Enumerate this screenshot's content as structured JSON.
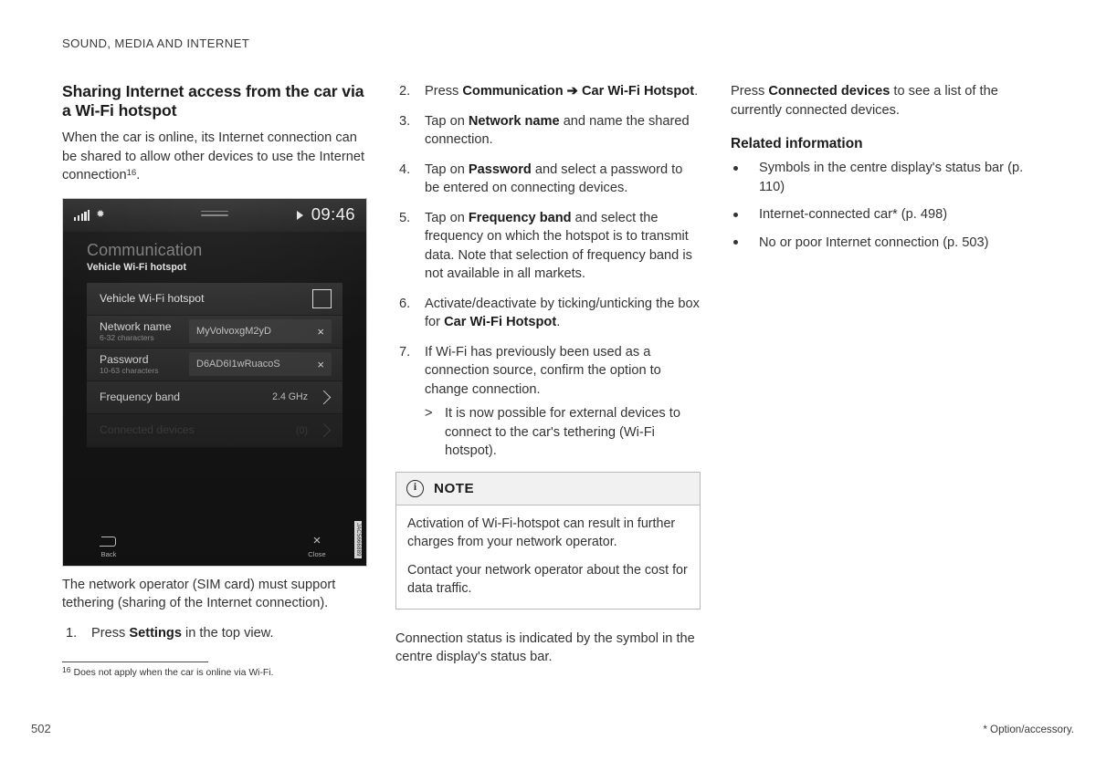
{
  "running_head": "SOUND, MEDIA AND INTERNET",
  "page_number": "502",
  "option_note": "* Option/accessory.",
  "column1": {
    "heading": "Sharing Internet access from the car via a Wi-Fi hotspot",
    "intro_a": "When the car is online, its Internet connection can be shared to allow other devices to use the Internet connection",
    "intro_footnote_marker": "16",
    "intro_b": ".",
    "caption_a": "The network operator (SIM card) must support tethering (sharing of the Internet connection).",
    "step1_num": "1.",
    "step1_a": "Press ",
    "step1_bold": "Settings",
    "step1_b": " in the top view."
  },
  "footnote": {
    "marker": "16",
    "text": "Does not apply when the car is online via Wi-Fi."
  },
  "car_display": {
    "status_bar": {
      "signal_icon": "signal-bars-icon",
      "bluetooth_icon": "bluetooth-icon",
      "menu_icon": "hamburger-icon",
      "play_icon": "play-icon",
      "clock": "09:46"
    },
    "title": "Communication",
    "subtitle": "Vehicle Wi-Fi hotspot",
    "rows": [
      {
        "label": "Vehicle Wi-Fi hotspot",
        "type": "checkbox",
        "checked": false
      },
      {
        "label": "Network name",
        "sublabel": "6-32 characters",
        "type": "input",
        "value": "MyVolvoxgM2yD",
        "clear_glyph": "×"
      },
      {
        "label": "Password",
        "sublabel": "10-63 characters",
        "type": "input",
        "value": "D6AD6I1wRuacoS",
        "clear_glyph": "×"
      },
      {
        "label": "Frequency band",
        "type": "nav",
        "value": "2.4 GHz"
      },
      {
        "label": "Connected devices",
        "type": "nav",
        "value": "(0)",
        "disabled": true
      }
    ],
    "back_button": {
      "label": "Back",
      "icon": "back-arrow-icon"
    },
    "close_button": {
      "label": "Close",
      "icon": "close-x-icon",
      "glyph": "×"
    },
    "image_id": "JAC5666889"
  },
  "column2": {
    "steps": [
      {
        "num": "2.",
        "parts": [
          {
            "t": "Press ",
            "b": false
          },
          {
            "t": "Communication",
            "b": true
          },
          {
            "t": " ➔ ",
            "b": true
          },
          {
            "t": "Car Wi-Fi Hotspot",
            "b": true
          },
          {
            "t": ".",
            "b": false
          }
        ]
      },
      {
        "num": "3.",
        "parts": [
          {
            "t": "Tap on ",
            "b": false
          },
          {
            "t": "Network name",
            "b": true
          },
          {
            "t": " and name the shared connection.",
            "b": false
          }
        ]
      },
      {
        "num": "4.",
        "parts": [
          {
            "t": "Tap on ",
            "b": false
          },
          {
            "t": "Password",
            "b": true
          },
          {
            "t": " and select a password to be entered on connecting devices.",
            "b": false
          }
        ]
      },
      {
        "num": "5.",
        "parts": [
          {
            "t": "Tap on ",
            "b": false
          },
          {
            "t": "Frequency band",
            "b": true
          },
          {
            "t": " and select the frequency on which the hotspot is to transmit data. Note that selection of frequency band is not available in all markets.",
            "b": false
          }
        ]
      },
      {
        "num": "6.",
        "parts": [
          {
            "t": "Activate/deactivate by ticking/unticking the box for ",
            "b": false
          },
          {
            "t": "Car Wi-Fi Hotspot",
            "b": true
          },
          {
            "t": ".",
            "b": false
          }
        ]
      },
      {
        "num": "7.",
        "parts": [
          {
            "t": "If Wi-Fi has previously been used as a connection source, confirm the option to change connection.",
            "b": false
          }
        ],
        "sub": [
          {
            "marker": ">",
            "text": "It is now possible for external devices to connect to the car's tethering (Wi-Fi hotspot)."
          }
        ]
      }
    ],
    "note": {
      "icon": "info-icon",
      "icon_glyph": "i",
      "label": "NOTE",
      "paragraphs": [
        "Activation of Wi-Fi-hotspot can result in further charges from your network operator.",
        "Contact your network operator about the cost for data traffic."
      ]
    },
    "closing_paragraph": "Connection status is indicated by the symbol in the centre display's status bar."
  },
  "column3": {
    "intro_a": "Press ",
    "intro_bold": "Connected devices",
    "intro_b": " to see a list of the currently connected devices.",
    "related_title": "Related information",
    "related_items": [
      "Symbols in the centre display's status bar (p. 110)",
      "Internet-connected car* (p. 498)",
      "No or poor Internet connection (p. 503)"
    ]
  }
}
